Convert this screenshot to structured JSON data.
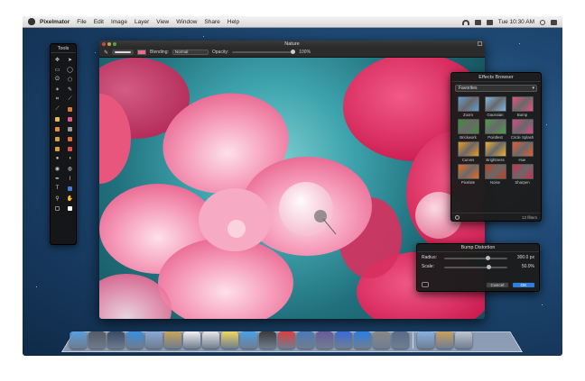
{
  "menubar": {
    "app_name": "Pixelmator",
    "menus": [
      "File",
      "Edit",
      "Image",
      "Layer",
      "View",
      "Window",
      "Share",
      "Help"
    ],
    "clock": "Tue 10:30 AM"
  },
  "tools": {
    "title": "Tools"
  },
  "main_window": {
    "title": "Nature",
    "blending_label": "Blending:",
    "blending_value": "Normal",
    "opacity_label": "Opacity:",
    "opacity_value": "100%",
    "canvas_colors": {
      "teal": "#3ea3ad",
      "pink": "#f27aa0",
      "magenta": "#e02a5a"
    }
  },
  "effects_browser": {
    "title": "Effects Browser",
    "category": "Favorites",
    "effects": [
      {
        "label": "Zoom",
        "color": "#5a9fd6"
      },
      {
        "label": "Gaussian",
        "color": "#7eb9e6"
      },
      {
        "label": "Bump",
        "color": "#e8507a"
      },
      {
        "label": "Brickwork",
        "color": "#3c8f3a"
      },
      {
        "label": "Pointlest",
        "color": "#4aa04a"
      },
      {
        "label": "Circle Splash",
        "color": "#d8488a"
      },
      {
        "label": "Curves",
        "color": "#e89a22"
      },
      {
        "label": "Brightness",
        "color": "#f0b030"
      },
      {
        "label": "Hue",
        "color": "#e85a30"
      },
      {
        "label": "Pixelate",
        "color": "#e86a20"
      },
      {
        "label": "Noise",
        "color": "#c04020"
      },
      {
        "label": "Sharpen",
        "color": "#d03050"
      }
    ],
    "count": "12 filters"
  },
  "bump_distortion": {
    "title": "Bump Distortion",
    "radius_label": "Radius:",
    "radius_value": "300.0 px",
    "radius_level": 0.7,
    "scale_label": "Scale:",
    "scale_value": "50.0%",
    "scale_level": 0.72,
    "cancel_label": "Cancel",
    "ok_label": "OK"
  },
  "dock": {
    "icons": [
      {
        "name": "finder-icon",
        "color": "#5b9ee0"
      },
      {
        "name": "launchpad-icon",
        "color": "#555a66"
      },
      {
        "name": "mission-control-icon",
        "color": "#3a4a66"
      },
      {
        "name": "safari-icon",
        "color": "#3a8ee0"
      },
      {
        "name": "mail-icon",
        "color": "#8aa8d8"
      },
      {
        "name": "contacts-icon",
        "color": "#c9a35a"
      },
      {
        "name": "calendar-icon",
        "color": "#f2f2f2"
      },
      {
        "name": "reminders-icon",
        "color": "#e8e8e8"
      },
      {
        "name": "notes-icon",
        "color": "#f0d860"
      },
      {
        "name": "messages-icon",
        "color": "#4aa0e8"
      },
      {
        "name": "facetime-icon",
        "color": "#3a3a3a"
      },
      {
        "name": "photo-booth-icon",
        "color": "#d84040"
      },
      {
        "name": "iphoto-icon",
        "color": "#4a7ab8"
      },
      {
        "name": "imovie-icon",
        "color": "#6a5a9a"
      },
      {
        "name": "itunes-icon",
        "color": "#3a6ad8"
      },
      {
        "name": "app-store-icon",
        "color": "#2a7ee0"
      },
      {
        "name": "system-preferences-icon",
        "color": "#888888"
      },
      {
        "name": "pixelmator-icon",
        "color": "#5a6a88"
      },
      {
        "name": "folder-icon",
        "color": "#8ab0e0"
      },
      {
        "name": "documents-icon",
        "color": "#c8a060"
      },
      {
        "name": "trash-icon",
        "color": "#bfc6cf"
      }
    ]
  }
}
